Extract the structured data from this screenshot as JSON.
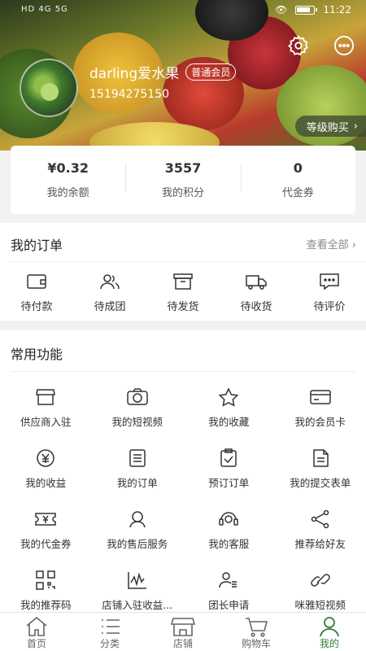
{
  "status_bar": {
    "network": "HD 4G 5G",
    "time": "11:22"
  },
  "profile": {
    "username": "darling爱水果",
    "member_badge": "普通会员",
    "phone": "15194275150",
    "level_buy": "等级购买"
  },
  "stats": [
    {
      "value": "¥0.32",
      "label": "我的余额"
    },
    {
      "value": "3557",
      "label": "我的积分"
    },
    {
      "value": "0",
      "label": "代金券"
    }
  ],
  "orders": {
    "title": "我的订单",
    "view_all": "查看全部",
    "items": [
      {
        "label": "待付款",
        "icon": "wallet-icon"
      },
      {
        "label": "待成团",
        "icon": "group-icon"
      },
      {
        "label": "待发货",
        "icon": "box-icon"
      },
      {
        "label": "待收货",
        "icon": "truck-icon"
      },
      {
        "label": "待评价",
        "icon": "comment-icon"
      }
    ]
  },
  "functions": {
    "title": "常用功能",
    "items": [
      {
        "label": "供应商入驻",
        "icon": "store-icon"
      },
      {
        "label": "我的短视频",
        "icon": "camera-icon"
      },
      {
        "label": "我的收藏",
        "icon": "star-icon"
      },
      {
        "label": "我的会员卡",
        "icon": "card-icon"
      },
      {
        "label": "我的收益",
        "icon": "yen-coin-icon"
      },
      {
        "label": "我的订单",
        "icon": "order-list-icon"
      },
      {
        "label": "预订订单",
        "icon": "clipboard-check-icon"
      },
      {
        "label": "我的提交表单",
        "icon": "form-icon"
      },
      {
        "label": "我的代金券",
        "icon": "voucher-icon"
      },
      {
        "label": "我的售后服务",
        "icon": "service-icon"
      },
      {
        "label": "我的客服",
        "icon": "headset-icon"
      },
      {
        "label": "推荐给好友",
        "icon": "share-icon"
      },
      {
        "label": "我的推荐码",
        "icon": "qrcode-icon"
      },
      {
        "label": "店铺入驻收益...",
        "icon": "chart-icon"
      },
      {
        "label": "团长申请",
        "icon": "leader-icon"
      },
      {
        "label": "咪雅短视频",
        "icon": "link-icon"
      }
    ]
  },
  "tabbar": [
    {
      "label": "首页",
      "icon": "home-icon"
    },
    {
      "label": "分类",
      "icon": "category-icon"
    },
    {
      "label": "店铺",
      "icon": "shop-icon"
    },
    {
      "label": "购物车",
      "icon": "cart-icon"
    },
    {
      "label": "我的",
      "icon": "user-icon",
      "active": true
    }
  ],
  "colors": {
    "accent": "#2e7d32"
  }
}
